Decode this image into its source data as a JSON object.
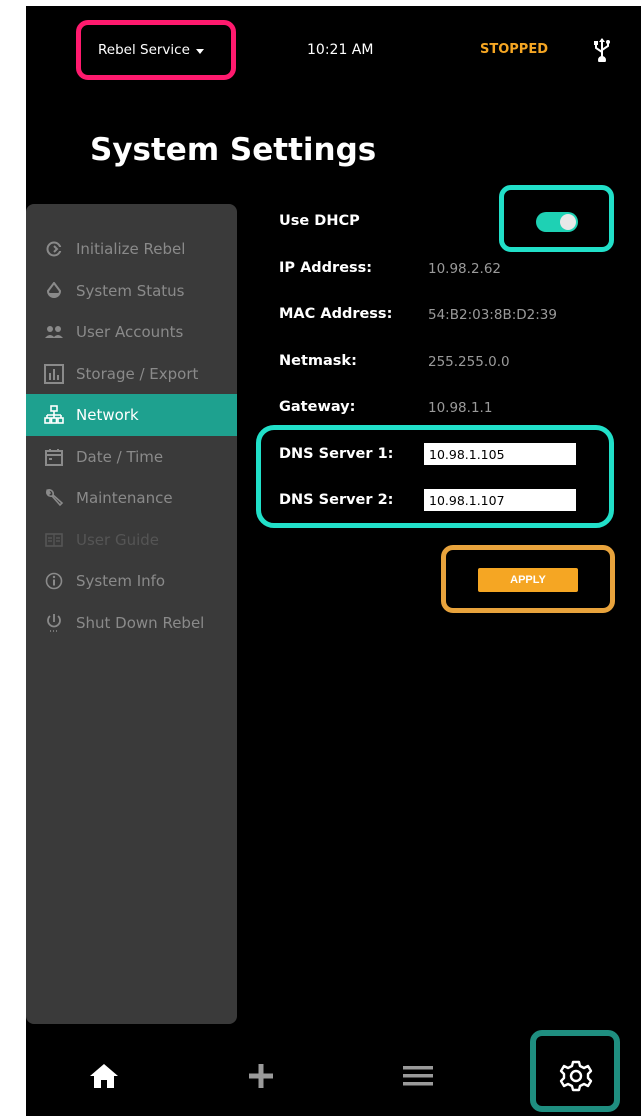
{
  "status_bar": {
    "service_label": "Rebel Service",
    "time": "10:21 AM",
    "state": "STOPPED",
    "state_color": "#f5a623",
    "usb_icon": "usb-icon"
  },
  "page": {
    "title": "System Settings"
  },
  "sidebar": {
    "items": [
      {
        "label": "Initialize Rebel",
        "icon": "refresh-icon"
      },
      {
        "label": "System Status",
        "icon": "drop-icon"
      },
      {
        "label": "User Accounts",
        "icon": "users-icon"
      },
      {
        "label": "Storage / Export",
        "icon": "bar-chart-icon"
      },
      {
        "label": "Network",
        "icon": "network-icon",
        "active": true
      },
      {
        "label": "Date / Time",
        "icon": "calendar-icon"
      },
      {
        "label": "Maintenance",
        "icon": "wrench-icon"
      },
      {
        "label": "User Guide",
        "icon": "guide-icon",
        "disabled": true
      },
      {
        "label": "System Info",
        "icon": "info-icon"
      },
      {
        "label": "Shut Down Rebel",
        "icon": "power-icon"
      }
    ]
  },
  "network": {
    "use_dhcp_label": "Use DHCP",
    "use_dhcp_on": true,
    "ip_label": "IP Address:",
    "ip_value": "10.98.2.62",
    "mac_label": "MAC Address:",
    "mac_value": "54:B2:03:8B:D2:39",
    "netmask_label": "Netmask:",
    "netmask_value": "255.255.0.0",
    "gateway_label": "Gateway:",
    "gateway_value": "10.98.1.1",
    "dns1_label": "DNS Server 1:",
    "dns1_value": "10.98.1.105",
    "dns2_label": "DNS Server 2:",
    "dns2_value": "10.98.1.107",
    "apply_label": "APPLY"
  },
  "colors": {
    "accent_teal": "#1ea18f",
    "toggle_on": "#1ed1b4",
    "apply": "#f5a623",
    "highlight_pink": "#ff1a6e",
    "highlight_cyan": "#21e0c9",
    "highlight_orange": "#e8a33c",
    "highlight_teal_dark": "#1f8e80"
  },
  "bottom_nav": {
    "items": [
      "home-icon",
      "plus-icon",
      "menu-icon",
      "gear-icon"
    ],
    "active": "gear-icon"
  }
}
